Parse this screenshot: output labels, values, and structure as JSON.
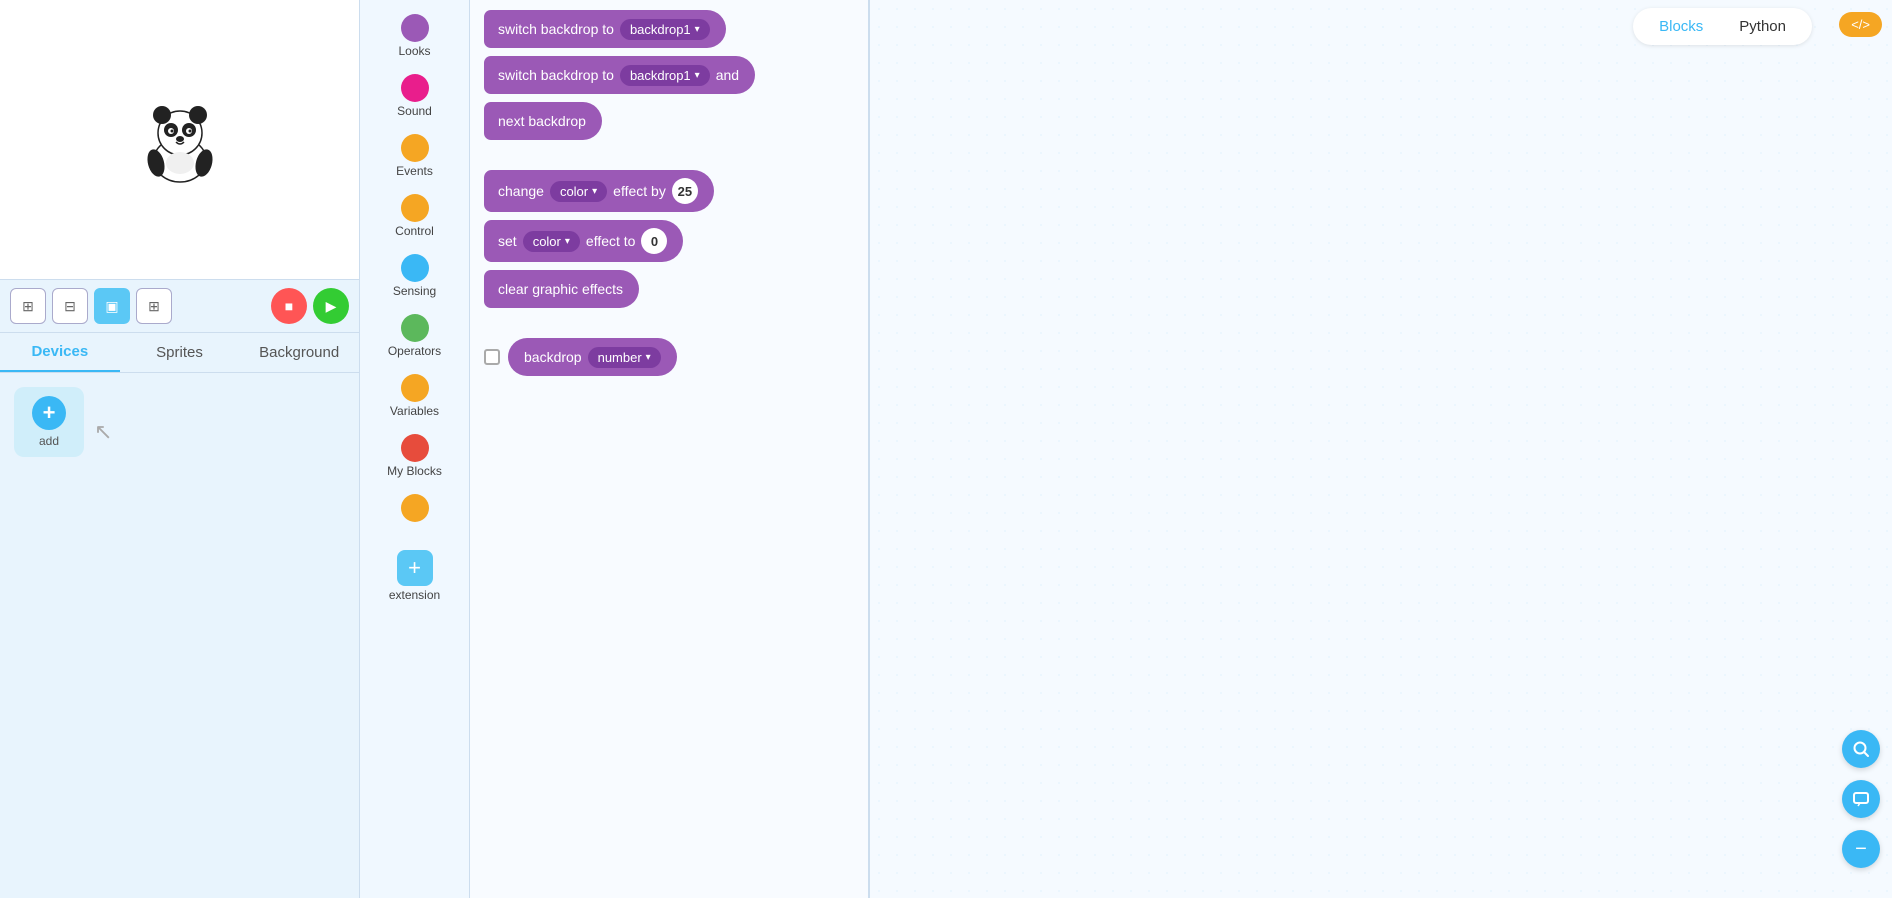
{
  "tabs": {
    "blocks_label": "Blocks",
    "python_label": "Python"
  },
  "header": {
    "blocks_active": true,
    "code_icon": "</>",
    "orange_badge": "</>"
  },
  "left_panel": {
    "tabs": [
      "Devices",
      "Sprites",
      "Background"
    ],
    "active_tab": "Devices",
    "add_label": "add"
  },
  "toolbar": {
    "buttons": [
      "⊞",
      "⊟",
      "▣",
      "⊞"
    ],
    "stop_icon": "■",
    "go_icon": "▶"
  },
  "categories": [
    {
      "name": "Looks",
      "color": "#9b59b6",
      "id": "looks"
    },
    {
      "name": "Sound",
      "color": "#e91e8c",
      "id": "sound"
    },
    {
      "name": "Events",
      "color": "#f5a623",
      "id": "events"
    },
    {
      "name": "Control",
      "color": "#f5a623",
      "id": "control"
    },
    {
      "name": "Sensing",
      "color": "#3ab8f5",
      "id": "sensing"
    },
    {
      "name": "Operators",
      "color": "#5cb85c",
      "id": "operators"
    },
    {
      "name": "Variables",
      "color": "#f5a623",
      "id": "variables"
    },
    {
      "name": "My Blocks",
      "color": "#e74c3c",
      "id": "myblocks"
    },
    {
      "name": "",
      "color": "#f5a623",
      "id": "extra"
    },
    {
      "name": "extension",
      "color": "#3ab8f5",
      "id": "extension",
      "is_plus": true
    }
  ],
  "blocks": [
    {
      "id": "switch_backdrop1",
      "type": "command",
      "text_parts": [
        "switch backdrop to",
        "backdrop1",
        ""
      ],
      "color": "#9b59b6"
    },
    {
      "id": "switch_backdrop_wait",
      "type": "command",
      "text_parts": [
        "switch backdrop to",
        "backdrop1",
        "and"
      ],
      "color": "#9b59b6"
    },
    {
      "id": "next_backdrop",
      "type": "command",
      "text": "next backdrop",
      "color": "#9b59b6"
    },
    {
      "id": "change_color",
      "type": "command",
      "text_before": "change",
      "effect": "color",
      "text_mid": "effect by",
      "value": "25",
      "color": "#9b59b6"
    },
    {
      "id": "set_color",
      "type": "command",
      "text_before": "set",
      "effect": "color",
      "text_mid": "effect to",
      "value": "0",
      "color": "#9b59b6"
    },
    {
      "id": "clear_effects",
      "type": "command",
      "text": "clear graphic effects",
      "color": "#9b59b6"
    },
    {
      "id": "backdrop_number",
      "type": "reporter",
      "text_before": "backdrop",
      "prop": "number",
      "color": "#9b59b6",
      "has_checkbox": true
    }
  ],
  "canvas": {
    "background": "dotted"
  },
  "fab": {
    "search_icon": "🔍",
    "comment_icon": "💬",
    "minus_icon": "−"
  }
}
